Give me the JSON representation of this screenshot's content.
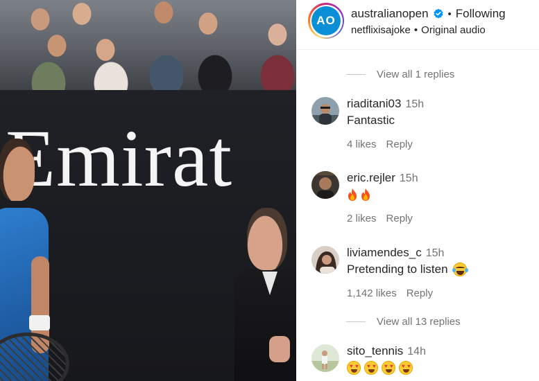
{
  "media": {
    "board_text": "Emirat",
    "alt": "Tennis match video frame"
  },
  "header": {
    "username": "australianopen",
    "logo_text": "AO",
    "follow_status": "Following",
    "separator": "•",
    "audio_owner": "netflixisajoke",
    "audio_label": "Original audio",
    "verified_color": "#0095f6",
    "logo_color": "#0a8fd6"
  },
  "replies_toggle_1": "View all 1 replies",
  "replies_toggle_2": "View all 13 replies",
  "comments": [
    {
      "username": "riaditani03",
      "time": "15h",
      "text": "Fantastic",
      "likes": "4 likes",
      "reply": "Reply",
      "avatar_color": "#6d7a86"
    },
    {
      "username": "eric.rejler",
      "time": "15h",
      "text": "",
      "emojis": [
        "fire",
        "fire"
      ],
      "likes": "2 likes",
      "reply": "Reply",
      "avatar_color": "#3b3630"
    },
    {
      "username": "liviamendes_c",
      "time": "15h",
      "text": "Pretending to listen",
      "emojis": [
        "laughing-with-tears"
      ],
      "likes": "1,142 likes",
      "reply": "Reply",
      "avatar_color": "#8a6e5c"
    },
    {
      "username": "sito_tennis",
      "time": "14h",
      "text": "",
      "emojis": [
        "heart-eyes",
        "heart-eyes",
        "heart-eyes",
        "heart-eyes"
      ],
      "avatar_color": "#c9d6b7"
    }
  ]
}
